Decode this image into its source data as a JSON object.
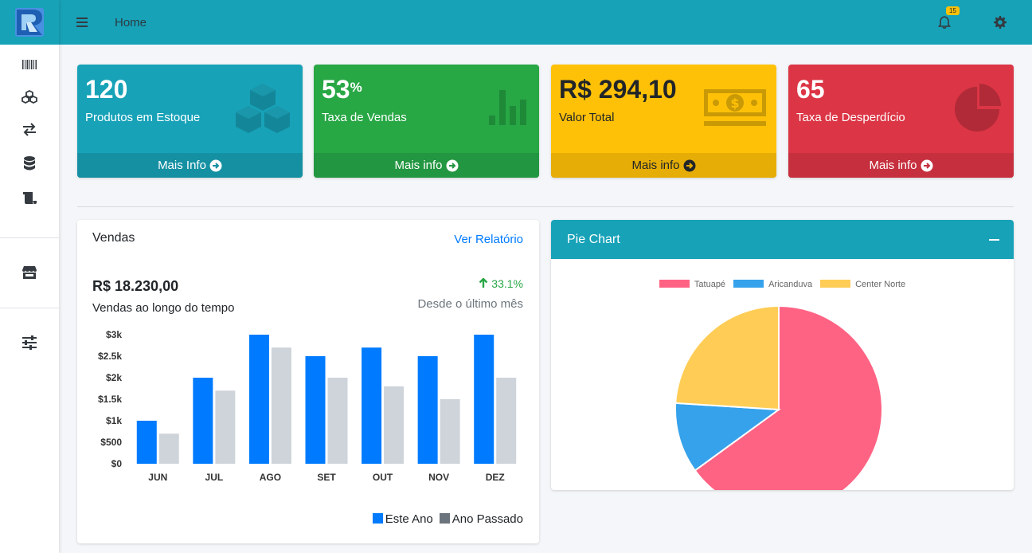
{
  "topbar": {
    "home_label": "Home",
    "notification_count": "15"
  },
  "sidebar": {
    "items": [
      {
        "icon": "barcode-icon"
      },
      {
        "icon": "cubes-icon"
      },
      {
        "icon": "exchange-icon"
      },
      {
        "icon": "database-icon"
      },
      {
        "icon": "scroll-icon"
      },
      {
        "icon": "store-icon"
      },
      {
        "icon": "sliders-icon"
      }
    ]
  },
  "boxes": [
    {
      "value": "120",
      "label": "Produtos em Estoque",
      "footer": "Mais Info",
      "color": "#17a2b8",
      "icon": "cubes-icon"
    },
    {
      "value": "53",
      "suffix": "%",
      "label": "Taxa de Vendas",
      "footer": "Mais info",
      "color": "#28a745",
      "icon": "chart-bars-icon"
    },
    {
      "value": "R$ 294,10",
      "label": "Valor Total",
      "footer": "Mais info",
      "color": "#ffc107",
      "icon": "money-bill-icon"
    },
    {
      "value": "65",
      "label": "Taxa de Desperdício",
      "footer": "Mais info",
      "color": "#dc3545",
      "icon": "pie-chart-icon"
    }
  ],
  "sales": {
    "title": "Vendas",
    "report_link": "Ver Relatório",
    "amount": "R$ 18.230,00",
    "amount_label": "Vendas ao longo do tempo",
    "change": "33.1%",
    "change_label": "Desde o último mês",
    "legend_this_year": "Este Ano",
    "legend_last_year": "Ano Passado"
  },
  "pie": {
    "title": "Pie Chart"
  },
  "chart_data": [
    {
      "type": "bar",
      "categories": [
        "JUN",
        "JUL",
        "AGO",
        "SET",
        "OUT",
        "NOV",
        "DEZ"
      ],
      "series": [
        {
          "name": "Este Ano",
          "values": [
            1000,
            2000,
            3000,
            2500,
            2700,
            2500,
            3000
          ],
          "color": "#007bff"
        },
        {
          "name": "Ano Passado",
          "values": [
            700,
            1700,
            2700,
            2000,
            1800,
            1500,
            2000
          ],
          "color": "#ced4da"
        }
      ],
      "yticks": [
        "$0",
        "$500",
        "$1k",
        "$1.5k",
        "$2k",
        "$2.5k",
        "$3k"
      ],
      "ylim": [
        0,
        3000
      ],
      "grid": false,
      "legend": "bottom-right"
    },
    {
      "type": "pie",
      "labels": [
        "Tatuapé",
        "Aricanduva",
        "Center Norte"
      ],
      "values": [
        65,
        11,
        24
      ],
      "colors": [
        "#ff6384",
        "#36a2eb",
        "#ffcd56"
      ],
      "legend": "top"
    }
  ]
}
